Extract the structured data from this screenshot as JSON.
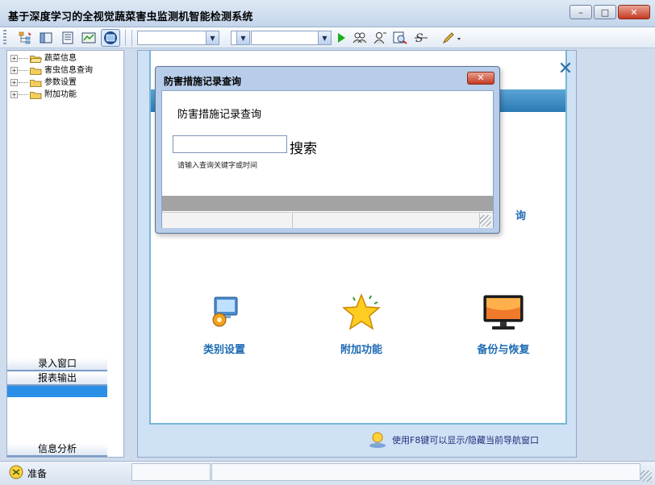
{
  "app": {
    "title": "基于深度学习的全视觉蔬菜害虫监测机智能检测系统"
  },
  "window_controls": {
    "minimize": "–",
    "maximize": "□",
    "close": "✕"
  },
  "tree": {
    "items": [
      {
        "expander": "+",
        "label": "蔬菜信息"
      },
      {
        "expander": "+",
        "label": "害虫信息查询"
      },
      {
        "expander": "+",
        "label": "参数设置"
      },
      {
        "expander": "+",
        "label": "附加功能"
      }
    ]
  },
  "left_nav": {
    "entry_window": "录入窗口",
    "report_output": "报表输出",
    "info_analysis": "信息分析"
  },
  "content": {
    "close_symbol": "✕",
    "partial_label": "询",
    "features": [
      {
        "label": "类别设置"
      },
      {
        "label": "附加功能"
      },
      {
        "label": "备份与恢复"
      }
    ],
    "hint": "使用F8键可以显示/隐藏当前导航窗口"
  },
  "dialog": {
    "title": "防害措施记录查询",
    "close_symbol": "✕",
    "heading": "防害措施记录查询",
    "input_value": "",
    "search_label": "搜索",
    "tip": "请输入查询关键字或时间"
  },
  "statusbar": {
    "text": "准备"
  },
  "colors": {
    "accent": "#2b8fe8",
    "feature_text": "#1d6bb4"
  }
}
